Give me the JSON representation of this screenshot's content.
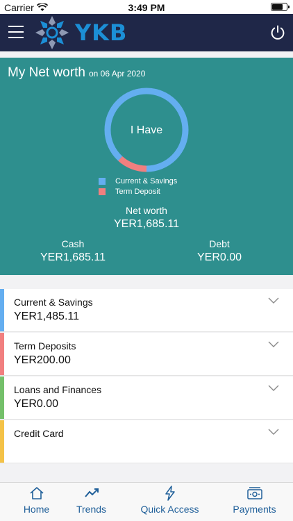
{
  "status": {
    "carrier": "Carrier",
    "time": "3:49 PM"
  },
  "header": {
    "brand": "YKB",
    "menu_icon": "hamburger-icon",
    "power_icon": "power-icon"
  },
  "networth": {
    "title": "My Net worth",
    "date": "on 06 Apr 2020",
    "center_label": "I Have",
    "legend": [
      {
        "label": "Current & Savings",
        "color": "#64aef0"
      },
      {
        "label": "Term Deposit",
        "color": "#f17f7f"
      }
    ],
    "net_label": "Net worth",
    "net_value": "YER1,685.11",
    "cash_label": "Cash",
    "cash_value": "YER1,685.11",
    "debt_label": "Debt",
    "debt_value": "YER0.00",
    "chart_slices": [
      1485.11,
      200.0
    ]
  },
  "accounts": [
    {
      "name": "Current & Savings",
      "amount": "YER1,485.11",
      "color": "#64aef0"
    },
    {
      "name": "Term Deposits",
      "amount": "YER200.00",
      "color": "#f17f7f"
    },
    {
      "name": "Loans and Finances",
      "amount": "YER0.00",
      "color": "#74c06a"
    },
    {
      "name": "Credit Card",
      "amount": "",
      "color": "#f4c247"
    }
  ],
  "tabs": [
    {
      "label": "Home",
      "icon": "home-icon"
    },
    {
      "label": "Trends",
      "icon": "trends-icon"
    },
    {
      "label": "Quick Access",
      "icon": "lightning-icon"
    },
    {
      "label": "Payments",
      "icon": "payments-icon"
    }
  ],
  "colors": {
    "nav": "#1f2748",
    "card": "#2e8f8e",
    "accent": "#1f5f99"
  }
}
